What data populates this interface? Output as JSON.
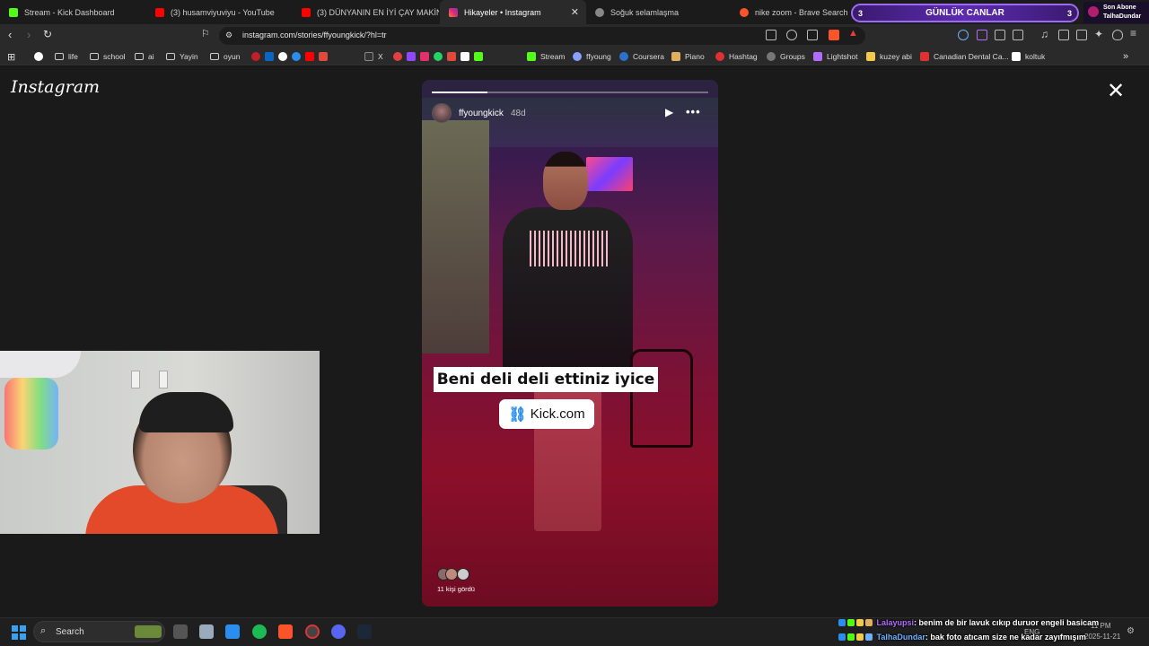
{
  "tabs": [
    {
      "label": "Stream - Kick Dashboard",
      "color": "#53fc18"
    },
    {
      "label": "(3) husamviyuviyu - YouTube",
      "color": "#ff0000"
    },
    {
      "label": "(3) DÜNYANIN EN İYİ ÇAY MAKİNESİ",
      "color": "#ff0000"
    },
    {
      "label": "Hikayeler • Instagram",
      "color": "#e1306c"
    },
    {
      "label": "Soğuk selamlaşma",
      "color": "#cccccc"
    },
    {
      "label": "nike zoom - Brave Search",
      "color": "#fb542b"
    }
  ],
  "overlay": {
    "gunluk_label": "GÜNLÜK CANLAR",
    "gunluk_left": "3",
    "gunluk_right": "3",
    "son_abone_label": "Son Abone",
    "son_abone_user": "TalhaDundar"
  },
  "address": {
    "url": "instagram.com/stories/ffyoungkick/?hl=tr"
  },
  "bookmarks": [
    {
      "label": "",
      "icon": "google-icon",
      "color": "#ffffff"
    },
    {
      "label": "life",
      "icon": "folder-icon"
    },
    {
      "label": "school",
      "icon": "folder-icon"
    },
    {
      "label": "ai",
      "icon": "folder-icon"
    },
    {
      "label": "Yayin",
      "icon": "folder-icon"
    },
    {
      "label": "oyun",
      "icon": "folder-icon"
    },
    {
      "label": "X",
      "icon": "x-icon",
      "color": "#cccccc"
    },
    {
      "label": "Stream",
      "icon": "kick-icon",
      "color": "#53fc18"
    },
    {
      "label": "ffyoung",
      "icon": "link-icon",
      "color": "#8aa0ff"
    },
    {
      "label": "Coursera",
      "icon": "coursera-icon",
      "color": "#2a73cc"
    },
    {
      "label": "Piano",
      "icon": "piano-icon",
      "color": "#e0b060"
    },
    {
      "label": "Hashtag",
      "icon": "hashtag-icon",
      "color": "#e03030"
    },
    {
      "label": "Groups",
      "icon": "groups-icon",
      "color": "#999999"
    },
    {
      "label": "Lightshot",
      "icon": "lightshot-icon",
      "color": "#b06cff"
    },
    {
      "label": "kuzey abi",
      "icon": "drive-icon",
      "color": "#f2c94c"
    },
    {
      "label": "Canadian Dental Ca...",
      "icon": "leaf-icon",
      "color": "#e03030"
    },
    {
      "label": "koltuk",
      "icon": "koltuk-icon",
      "color": "#ffffff"
    }
  ],
  "instagram": {
    "logo": "Instagram",
    "close": "✕"
  },
  "story": {
    "username": "ffyoungkick",
    "age": "48d",
    "caption": "Beni deli deli ettiniz iyice",
    "link_text": "Kick.com",
    "seen_by": "11 kişi gördü",
    "progress": 0.2
  },
  "taskbar": {
    "search_placeholder": "Search",
    "time": "11 PM",
    "date": "2025-11-21",
    "lang": "ENG"
  },
  "chat": [
    {
      "user": "Lalayupsi",
      "text": ": benim de bir lavuk cıkıp duruor engeli basicam"
    },
    {
      "user": "TalhaDundar",
      "text": ": bak foto atıcam size ne kadar zayıfmışım"
    }
  ],
  "colors": {
    "accent_purple": "#9c6cf0",
    "instagram_bg": "#1a1a1a",
    "link_blue": "#2a8ef0"
  }
}
